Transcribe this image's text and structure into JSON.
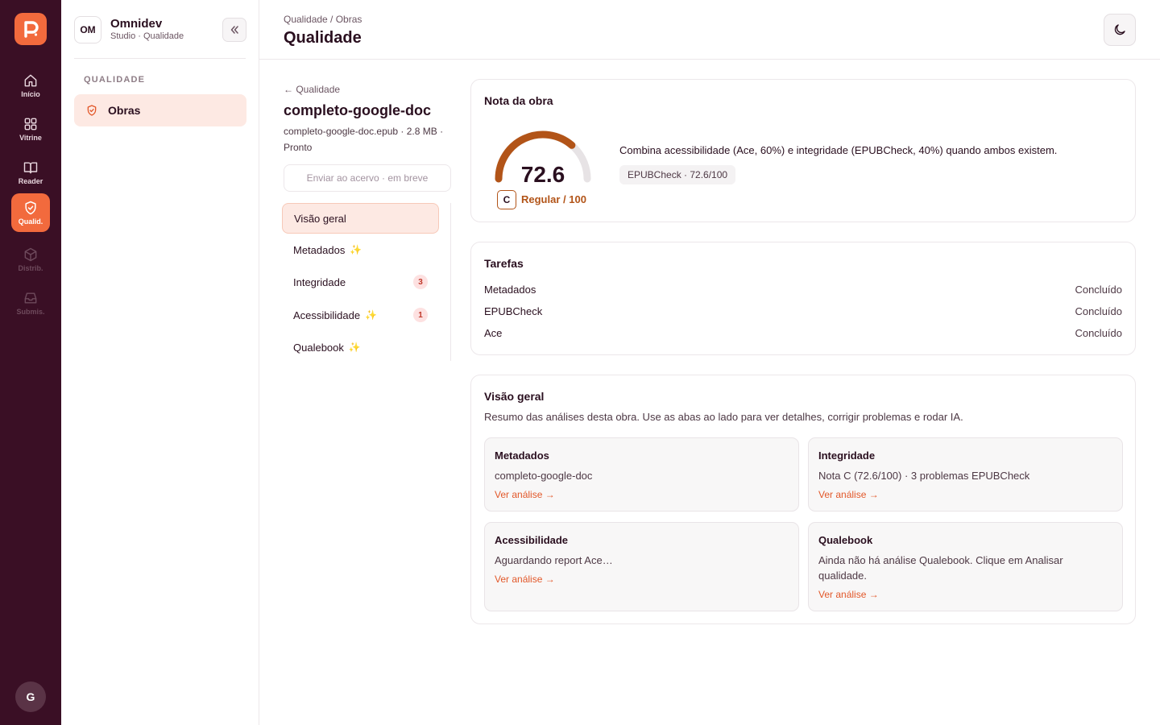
{
  "rail": {
    "items": [
      {
        "label": "Início",
        "icon": "home-icon"
      },
      {
        "label": "Vitrine",
        "icon": "grid-icon"
      },
      {
        "label": "Reader",
        "icon": "book-icon"
      },
      {
        "label": "Qualid.",
        "icon": "shield-check-icon"
      },
      {
        "label": "Distrib.",
        "icon": "box-icon"
      },
      {
        "label": "Submis.",
        "icon": "inbox-icon"
      }
    ],
    "avatar": "G",
    "accent": "#f26a3d",
    "background": "#3a0f25"
  },
  "sidebar": {
    "org_badge": "OM",
    "org_name": "Omnidev",
    "org_sub": "Studio · Qualidade",
    "section": "QUALIDADE",
    "item": "Obras"
  },
  "header": {
    "breadcrumb": "Qualidade / Obras",
    "title": "Qualidade"
  },
  "work": {
    "back": "← Qualidade",
    "title": "completo-google-doc",
    "meta": "completo-google-doc.epub · 2.8 MB · Pronto",
    "send_button": "Enviar ao acervo · em breve",
    "tabs": [
      {
        "label": "Visão geral",
        "ai": false,
        "count": null
      },
      {
        "label": "Metadados",
        "ai": true,
        "count": null
      },
      {
        "label": "Integridade",
        "ai": false,
        "count": "3"
      },
      {
        "label": "Acessibilidade",
        "ai": true,
        "count": "1"
      },
      {
        "label": "Qualebook",
        "ai": true,
        "count": null
      }
    ]
  },
  "score": {
    "title": "Nota da obra",
    "value": "72.6",
    "fraction": 0.726,
    "grade": "C",
    "grade_text": "Regular / 100",
    "description": "Combina acessibilidade (Ace, 60%) e integridade (EPUBCheck, 40%) quando ambos existem.",
    "chip": "EPUBCheck · 72.6/100",
    "gauge_color": "#b25418"
  },
  "tasks": {
    "title": "Tarefas",
    "rows": [
      {
        "name": "Metadados",
        "status": "Concluído"
      },
      {
        "name": "EPUBCheck",
        "status": "Concluído"
      },
      {
        "name": "Ace",
        "status": "Concluído"
      }
    ]
  },
  "overview": {
    "title": "Visão geral",
    "subtitle": "Resumo das análises desta obra. Use as abas ao lado para ver detalhes, corrigir problemas e rodar IA.",
    "cards": [
      {
        "title": "Metadados",
        "body": "completo-google-doc",
        "link": "Ver análise →"
      },
      {
        "title": "Integridade",
        "body": "Nota C (72.6/100) · 3 problemas EPUBCheck",
        "link": "Ver análise →"
      },
      {
        "title": "Acessibilidade",
        "body": "Aguardando report Ace…",
        "link": "Ver análise →"
      },
      {
        "title": "Qualebook",
        "body": "Ainda não há análise Qualebook. Clique em Analisar qualidade.",
        "link": "Ver análise →"
      }
    ]
  }
}
